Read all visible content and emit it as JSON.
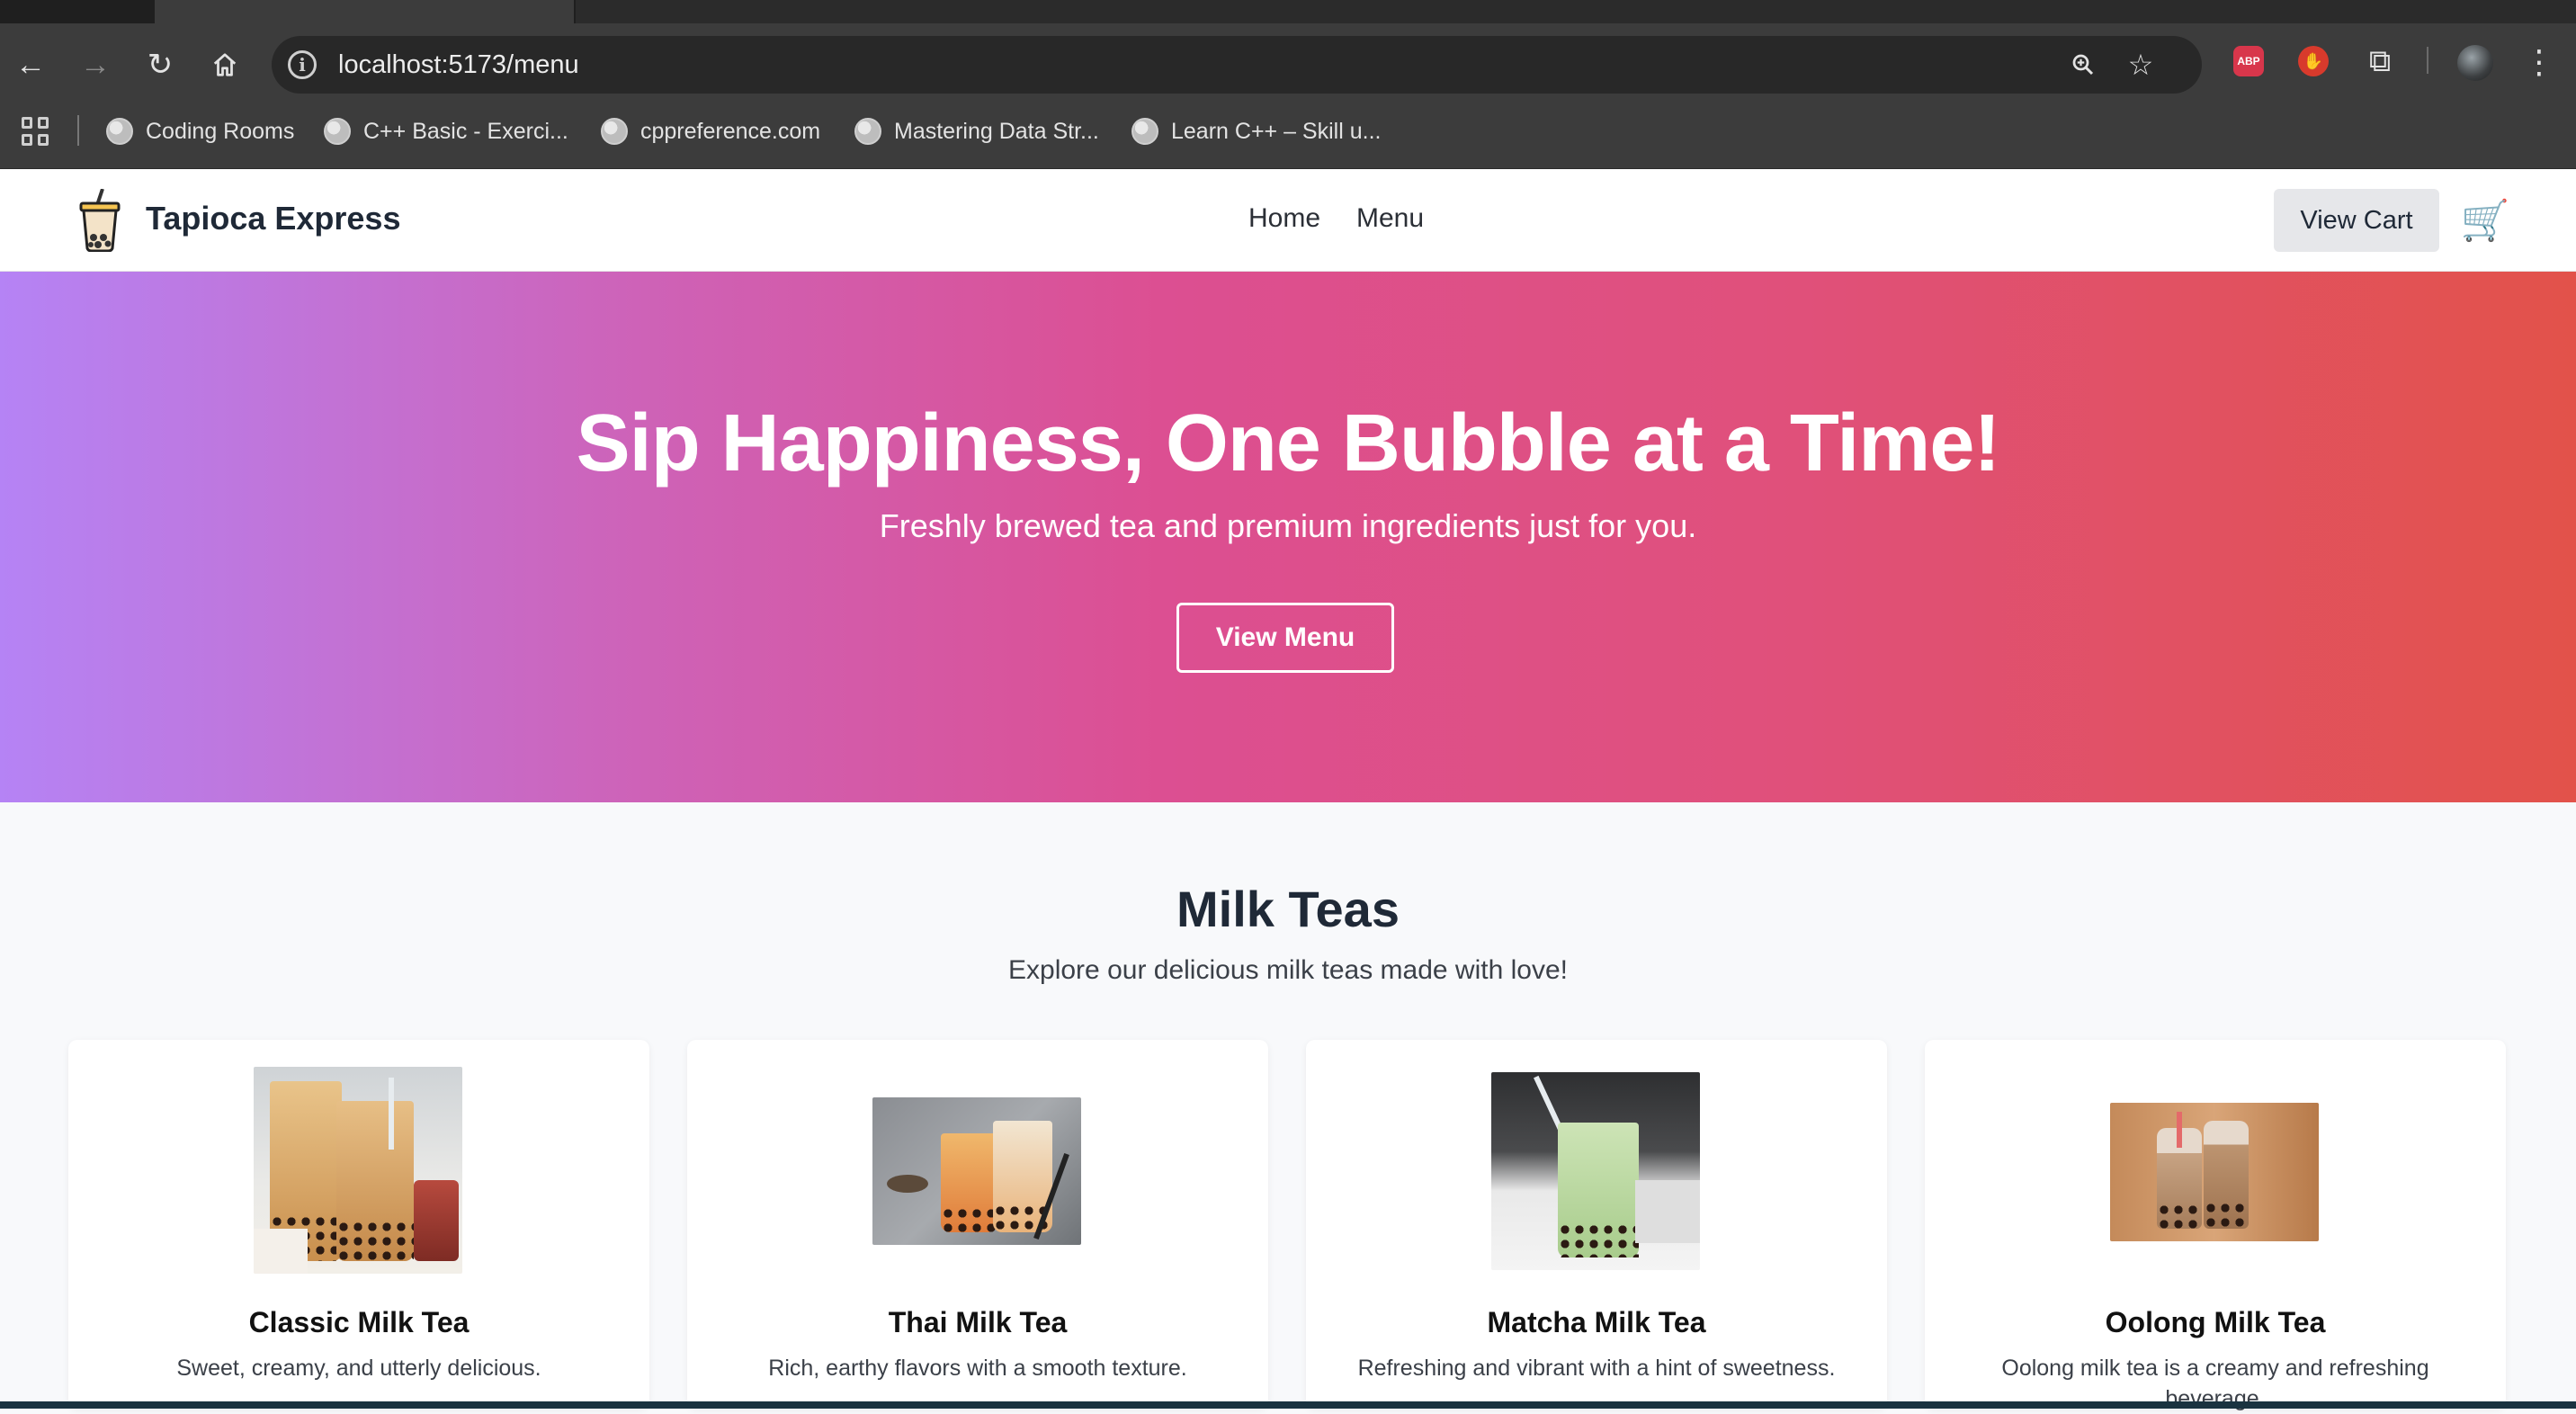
{
  "browser": {
    "url": "localhost:5173/menu",
    "bookmarks": [
      {
        "label": "Coding Rooms"
      },
      {
        "label": "C++ Basic - Exerci..."
      },
      {
        "label": "cppreference.com"
      },
      {
        "label": "Mastering Data Str..."
      },
      {
        "label": "Learn C++ – Skill u..."
      }
    ],
    "extensions": {
      "abp": "ABP"
    }
  },
  "header": {
    "brand": "Tapioca Express",
    "nav": [
      {
        "label": "Home"
      },
      {
        "label": "Menu"
      }
    ],
    "cart_button": "View Cart"
  },
  "hero": {
    "title": "Sip Happiness, One Bubble at a Time!",
    "subtitle": "Freshly brewed tea and premium ingredients just for you.",
    "cta": "View Menu"
  },
  "section": {
    "title": "Milk Teas",
    "subtitle": "Explore our delicious milk teas made with love!"
  },
  "products": [
    {
      "name": "Classic Milk Tea",
      "description": "Sweet, creamy, and utterly delicious."
    },
    {
      "name": "Thai Milk Tea",
      "description": "Rich, earthy flavors with a smooth texture."
    },
    {
      "name": "Matcha Milk Tea",
      "description": "Refreshing and vibrant with a hint of sweetness."
    },
    {
      "name": "Oolong Milk Tea",
      "description": "Oolong milk tea is a creamy and refreshing beverage."
    }
  ],
  "colors": {
    "hero_gradient": [
      "#b583f5",
      "#dc4f92",
      "#e2524a"
    ],
    "browser_toolbar": "#3c3c3c",
    "text_dark": "#1f2937"
  }
}
